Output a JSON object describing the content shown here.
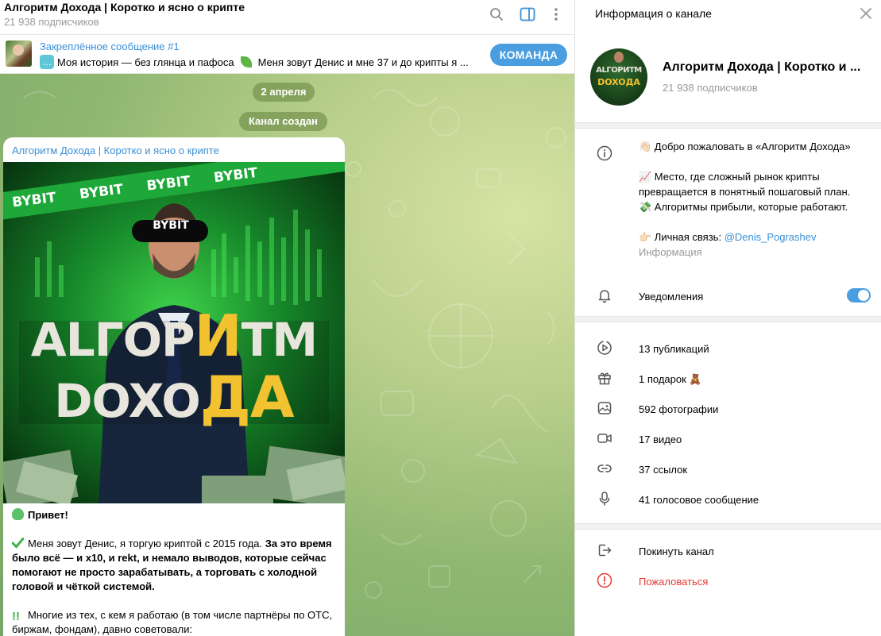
{
  "chat": {
    "title": "Алгоритм Дохода | Коротко и ясно о крипте",
    "subscribers": "21 938 подписчиков",
    "pinned": {
      "title": "Закреплённое сообщение #1",
      "text_a": "Моя история — без глянца и пафоса",
      "text_b": "Меня зовут Денис и мне 37 и до крипты я ...",
      "button": "КОМАНДА"
    },
    "date_pill": "2 апреля",
    "created_pill": "Канал создан",
    "message": {
      "author": "Алгоритм Дохода | Коротко и ясно о крипте",
      "photo": {
        "brand": "BYBIT",
        "headline_1a": "ALГОР",
        "headline_1b": "И",
        "headline_1c": "ТМ",
        "headline_2a": "DOXO",
        "headline_2b": "ДА"
      },
      "greeting": "Привет!",
      "p1_plain": "Меня зовут Денис, я торгую криптой с 2015 года. ",
      "p1_bold": "За это время было всё — и x10, и rekt, и немало выводов, которые сейчас помогают не просто зарабатывать, а торговать с холодной головой и чёткой системой.",
      "p2": "Многие из тех, с кем я работаю (в том числе партнёры по ОТС, биржам, фондам), давно советовали:"
    }
  },
  "panel": {
    "title": "Информация о канале",
    "avatar_text_1": "ALГОРИТМ",
    "avatar_text_2": "DOXOДА",
    "channel_name": "Алгоритм Дохода | Коротко и ...",
    "subscribers": "21 938 подписчиков",
    "description": {
      "line1": "👋🏻 Добро пожаловать в «Алгоритм Дохода»",
      "line2": "📈 Место, где сложный рынок крипты",
      "line3": "превращается в понятный пошаговый план.",
      "line4": "💸 Алгоритмы прибыли, которые работают.",
      "line5_prefix": "👉🏻 Личная связь: ",
      "line5_link": "@Denis_Pograshev",
      "caption": "Информация"
    },
    "notifications_label": "Уведомления",
    "notifications_on": true,
    "media": {
      "posts": "13 публикаций",
      "gifts": "1 подарок 🧸",
      "photos": "592 фотографии",
      "videos": "17 видео",
      "links": "37 ссылок",
      "voice": "41 голосовое сообщение"
    },
    "leave": "Покинуть канал",
    "report": "Пожаловаться"
  },
  "colors": {
    "accent": "#4a9ee0",
    "link": "#3a8fd6",
    "danger": "#e53935",
    "photo_green": "#1d8a2e",
    "headline_yellow": "#f2c230"
  }
}
